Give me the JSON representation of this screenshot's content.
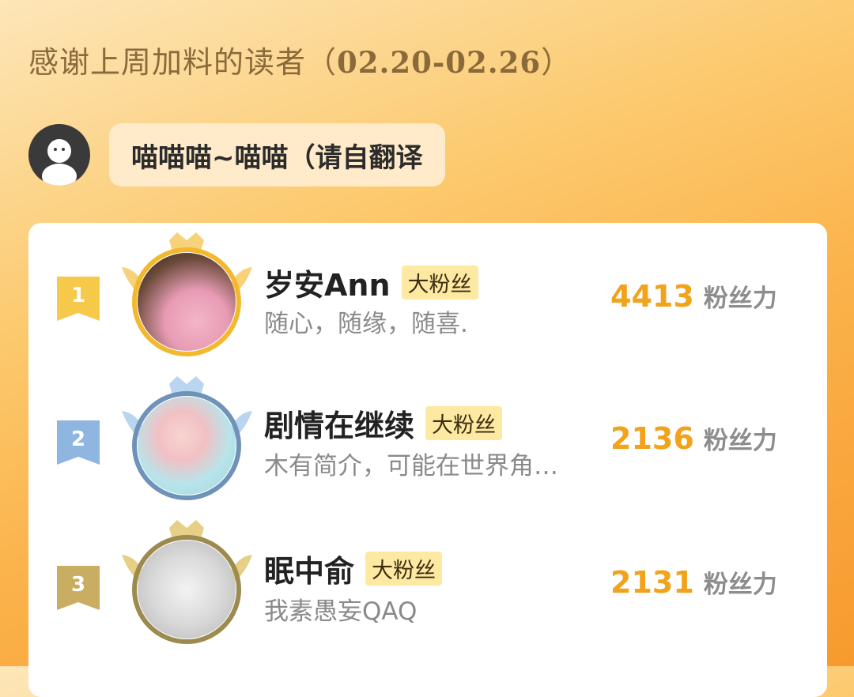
{
  "header": {
    "title_prefix": "感谢上周加料的读者（",
    "date_range": "02.20-02.26",
    "title_suffix": "）"
  },
  "author_message": {
    "avatar_icon": "ghost-avatar-icon",
    "text": "喵喵喵~喵喵（请自翻译"
  },
  "leaderboard": {
    "unit_label": "粉丝力",
    "entries": [
      {
        "rank": "1",
        "name": "岁安Ann",
        "tag": "大粉丝",
        "bio": "随心，随缘，随喜.",
        "score": "4413",
        "badge_color": "#f6c94a",
        "wing_color": "#f7d27a"
      },
      {
        "rank": "2",
        "name": "剧情在继续",
        "tag": "大粉丝",
        "bio": "木有简介，可能在世界角…",
        "score": "2136",
        "badge_color": "#8fb6e0",
        "wing_color": "#b9d5f0"
      },
      {
        "rank": "3",
        "name": "眠中俞",
        "tag": "大粉丝",
        "bio": "我素愚妄QAQ",
        "score": "2131",
        "badge_color": "#c8ad63",
        "wing_color": "#e6cf86"
      }
    ]
  }
}
